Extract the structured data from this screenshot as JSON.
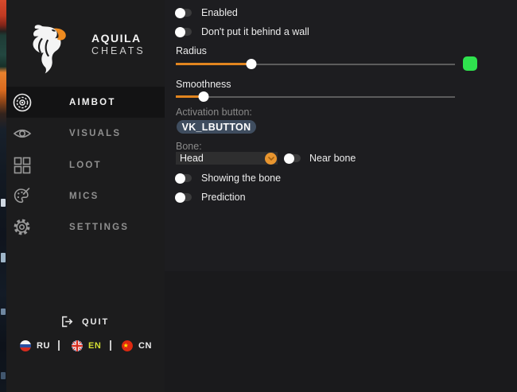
{
  "brand": {
    "name": "AQUILA",
    "subtitle": "CHEATS"
  },
  "sidebar": {
    "items": [
      {
        "label": "AIMBOT",
        "icon": "target-icon",
        "active": true
      },
      {
        "label": "VISUALS",
        "icon": "eye-icon",
        "active": false
      },
      {
        "label": "LOOT",
        "icon": "grid-icon",
        "active": false
      },
      {
        "label": "MICS",
        "icon": "palette-icon",
        "active": false
      },
      {
        "label": "SETTINGS",
        "icon": "gear-icon",
        "active": false
      }
    ],
    "quit_label": "QUIT",
    "languages": [
      {
        "code": "RU",
        "active": false
      },
      {
        "code": "EN",
        "active": true
      },
      {
        "code": "CN",
        "active": false
      }
    ]
  },
  "main": {
    "toggles_top": [
      {
        "label": "Enabled",
        "on": false
      },
      {
        "label": "Don't put it behind a wall",
        "on": false
      }
    ],
    "sliders": [
      {
        "label": "Radius",
        "value_pct": 27,
        "swatch_color": "#2fe24e"
      },
      {
        "label": "Smoothness",
        "value_pct": 10
      }
    ],
    "activation": {
      "label": "Activation button:",
      "value": "VK_LBUTTON"
    },
    "bone": {
      "label": "Bone:",
      "selected": "Head",
      "near_bone_label": "Near bone",
      "near_bone_on": false
    },
    "toggles_bottom": [
      {
        "label": "Showing the bone",
        "on": false
      },
      {
        "label": "Prediction",
        "on": false
      }
    ]
  },
  "colors": {
    "accent_orange": "#e2851f",
    "swatch_green": "#2fe24e",
    "active_lang": "#d5df33",
    "pill_blue": "#3f4d5f"
  }
}
